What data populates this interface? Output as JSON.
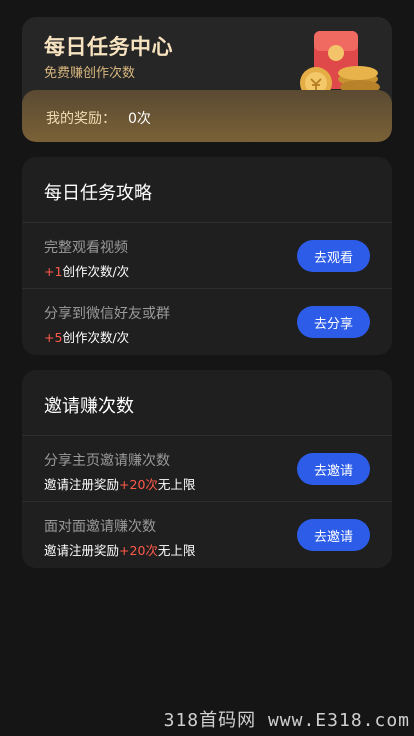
{
  "hero": {
    "title": "每日任务中心",
    "subtitle": "免费赚创作次数",
    "reward_label": "我的奖励：",
    "reward_value": "0次",
    "icon": "red-packet-coins-icon"
  },
  "daily": {
    "title": "每日任务攻略",
    "tasks": [
      {
        "name": "完整观看视频",
        "desc_prefix": "",
        "desc_highlight": "+1",
        "desc_suffix": "创作次数/次",
        "button": "去观看"
      },
      {
        "name": "分享到微信好友或群",
        "desc_prefix": "",
        "desc_highlight": "+5",
        "desc_suffix": "创作次数/次",
        "button": "去分享"
      }
    ]
  },
  "invite": {
    "title": "邀请赚次数",
    "tasks": [
      {
        "name": "分享主页邀请赚次数",
        "desc_prefix": "邀请注册奖励",
        "desc_highlight": "+20次",
        "desc_suffix": "无上限",
        "button": "去邀请"
      },
      {
        "name": "面对面邀请赚次数",
        "desc_prefix": "邀请注册奖励",
        "desc_highlight": "+20次",
        "desc_suffix": "无上限",
        "button": "去邀请"
      }
    ]
  },
  "watermark": "318首码网 www.E318.com",
  "colors": {
    "background": "#151515",
    "card": "#1f1f1f",
    "button": "#2c5ce8",
    "highlight": "#ff5a4a",
    "gold": "#f7e3bf"
  }
}
